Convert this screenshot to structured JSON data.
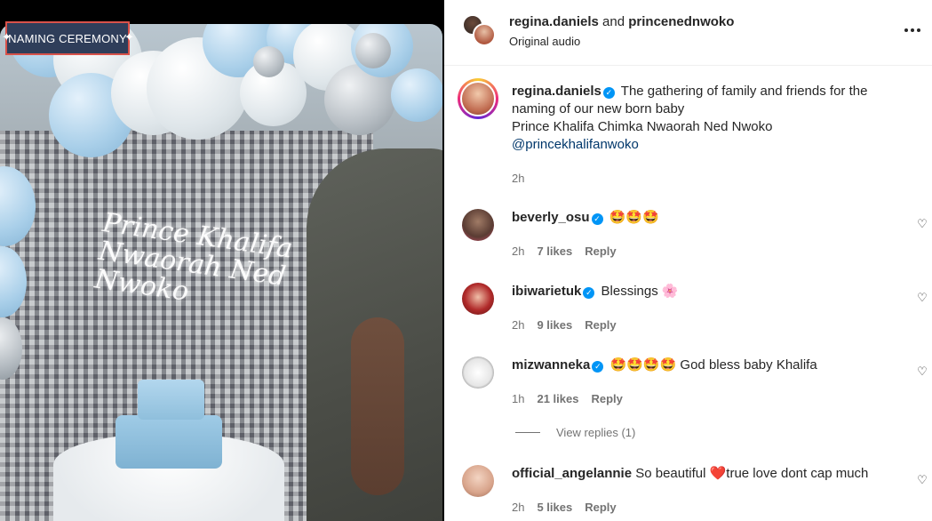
{
  "media": {
    "banner_label": "NAMING CEREMONY",
    "backdrop_script": "Prince Khalifa Nwaorah Ned Nwoko"
  },
  "header": {
    "author1": "regina.daniels",
    "and_text": "and",
    "author2": "princenednwoko",
    "audio": "Original audio"
  },
  "caption": {
    "username": "regina.daniels",
    "line1": "The gathering of family and friends for the naming of our new born baby",
    "line2": "Prince Khalifa Chimka Nwaorah Ned Nwoko",
    "mention": "@princekhalifanwoko",
    "time": "2h"
  },
  "comments": [
    {
      "username": "beverly_osu",
      "text": "🤩🤩🤩",
      "time": "2h",
      "likes": "7 likes",
      "reply": "Reply"
    },
    {
      "username": "ibiwarietuk",
      "text": "Blessings 🌸",
      "time": "2h",
      "likes": "9 likes",
      "reply": "Reply"
    },
    {
      "username": "mizwanneka",
      "text": "🤩🤩🤩🤩 God bless baby Khalifa",
      "time": "1h",
      "likes": "21 likes",
      "reply": "Reply"
    },
    {
      "username": "official_angelannie",
      "text": "So beautiful ❤️true love dont cap much",
      "time": "2h",
      "likes": "5 likes",
      "reply": "Reply"
    }
  ],
  "view_replies": "View replies (1)",
  "icons": {
    "more": "more-horizontal-icon",
    "heart": "heart-outline-icon",
    "verified": "verified-badge-icon"
  },
  "colors": {
    "link": "#00376b",
    "verified": "#0095f6",
    "muted": "#737373"
  }
}
